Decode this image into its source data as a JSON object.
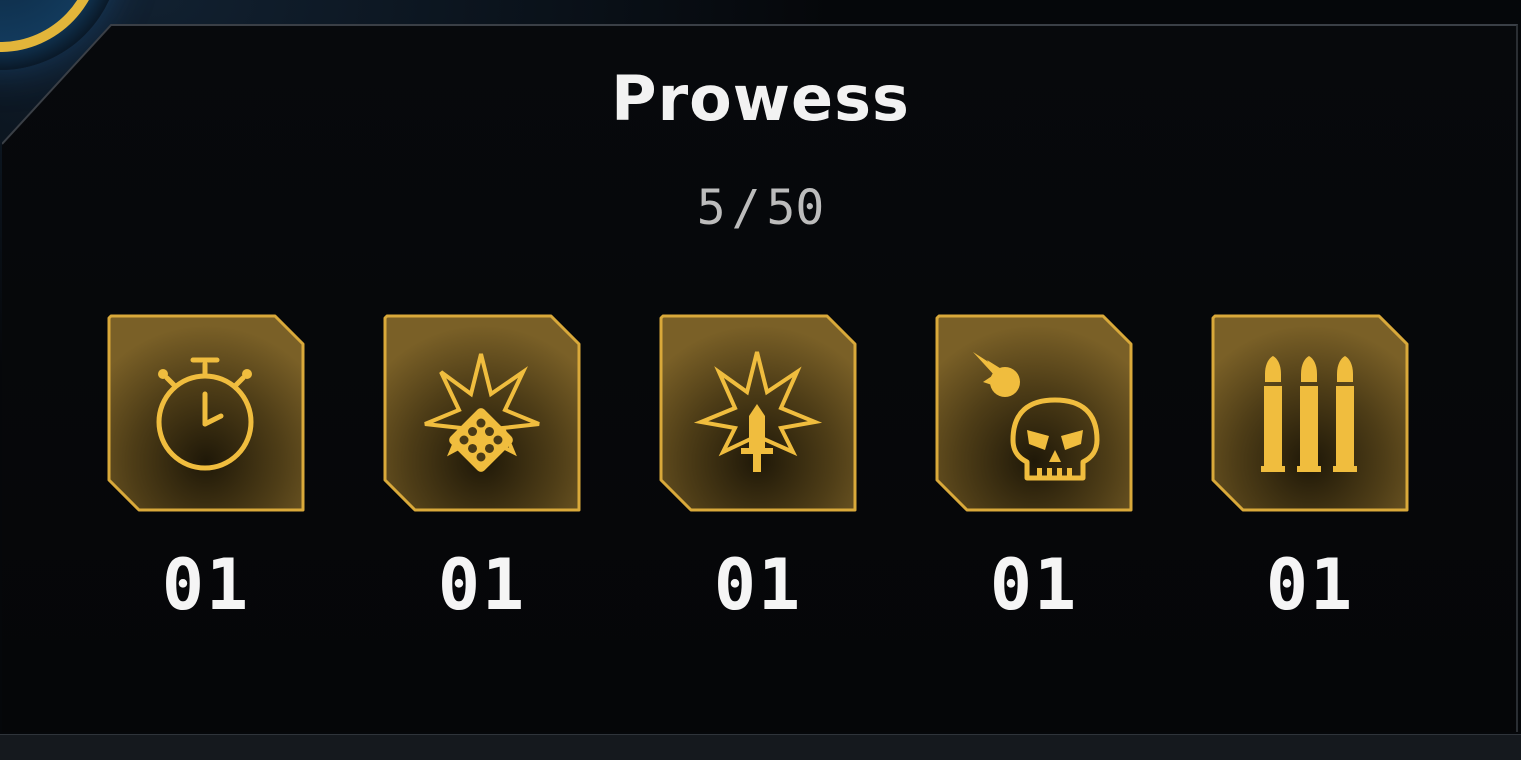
{
  "panel": {
    "title": "Prowess",
    "progress_current": "5",
    "progress_separator": "/",
    "progress_total": "50"
  },
  "colors": {
    "accent_gold": "#e8b840",
    "tile_fill": "#6b5420",
    "tile_border": "#d9a93a",
    "text_white": "#f2f2f2",
    "text_grey": "#bcbcbc",
    "background": "#05070a"
  },
  "badges": [
    {
      "icon": "stopwatch-icon",
      "count": "01"
    },
    {
      "icon": "dice-explosion-icon",
      "count": "01"
    },
    {
      "icon": "dagger-explosion-icon",
      "count": "01"
    },
    {
      "icon": "skull-explosion-icon",
      "count": "01"
    },
    {
      "icon": "bullets-icon",
      "count": "01"
    }
  ]
}
